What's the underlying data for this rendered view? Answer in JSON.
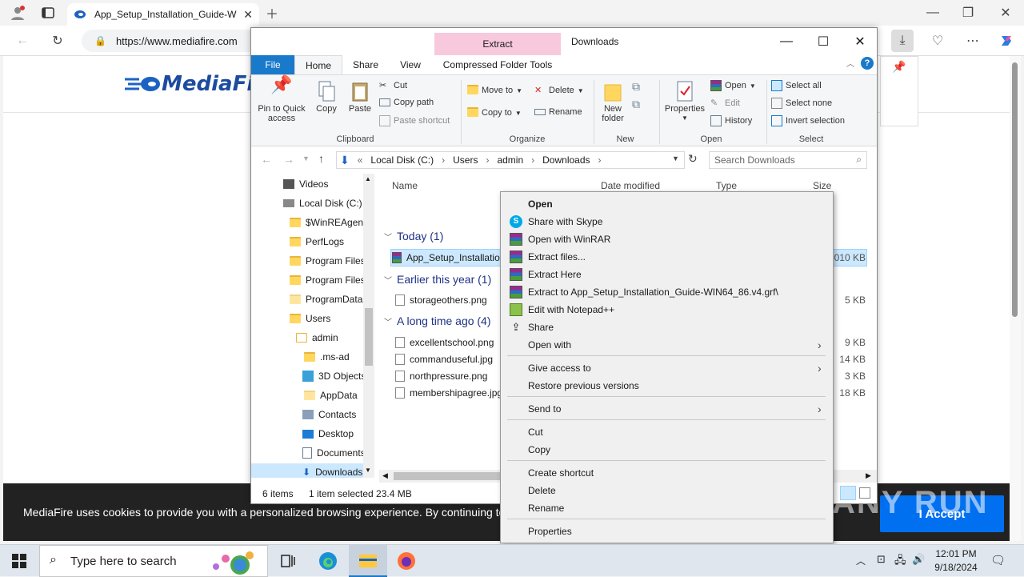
{
  "browser": {
    "tab_title": "App_Setup_Installation_Guide-W",
    "url": "https://www.mediafire.com"
  },
  "page": {
    "logo_text": "MediaFire",
    "cookie_text": "MediaFire uses cookies to provide you with a personalized browsing experience. By continuing to use th",
    "accept_label": "I Accept",
    "watermark": "ANY RUN"
  },
  "explorer": {
    "title": "Downloads",
    "contextual_tab": "Extract",
    "tabs": {
      "file": "File",
      "home": "Home",
      "share": "Share",
      "view": "View",
      "compressed": "Compressed Folder Tools"
    },
    "ribbon": {
      "pin": "Pin to Quick access",
      "copy": "Copy",
      "paste": "Paste",
      "cut": "Cut",
      "copy_path": "Copy path",
      "paste_shortcut": "Paste shortcut",
      "move_to": "Move to",
      "copy_to": "Copy to",
      "delete": "Delete",
      "rename": "Rename",
      "new_folder": "New folder",
      "properties": "Properties",
      "open": "Open",
      "edit": "Edit",
      "history": "History",
      "select_all": "Select all",
      "select_none": "Select none",
      "invert_selection": "Invert selection",
      "groups": {
        "clipboard": "Clipboard",
        "organize": "Organize",
        "new": "New",
        "open": "Open",
        "select": "Select"
      }
    },
    "breadcrumb": [
      "Local Disk (C:)",
      "Users",
      "admin",
      "Downloads"
    ],
    "search_placeholder": "Search Downloads",
    "nav": [
      {
        "label": "Videos"
      },
      {
        "label": "Local Disk (C:)"
      },
      {
        "label": "$WinREAgent"
      },
      {
        "label": "PerfLogs"
      },
      {
        "label": "Program Files"
      },
      {
        "label": "Program Files"
      },
      {
        "label": "ProgramData"
      },
      {
        "label": "Users"
      },
      {
        "label": "admin"
      },
      {
        "label": ".ms-ad"
      },
      {
        "label": "3D Objects"
      },
      {
        "label": "AppData"
      },
      {
        "label": "Contacts"
      },
      {
        "label": "Desktop"
      },
      {
        "label": "Documents"
      },
      {
        "label": "Downloads"
      }
    ],
    "columns": {
      "name": "Name",
      "date": "Date modified",
      "type": "Type",
      "size": "Size"
    },
    "groups": {
      "today": "Today (1)",
      "earlier": "Earlier this year (1)",
      "long_ago": "A long time ago (4)"
    },
    "files": [
      {
        "name": "App_Setup_Installatio",
        "size": ",010 KB"
      },
      {
        "name": "storageothers.png",
        "size": "5 KB"
      },
      {
        "name": "excellentschool.png",
        "size": "9 KB"
      },
      {
        "name": "commanduseful.jpg",
        "size": "14 KB"
      },
      {
        "name": "northpressure.png",
        "size": "3 KB"
      },
      {
        "name": "membershipagree.jpg",
        "size": "18 KB"
      }
    ],
    "status": {
      "items": "6 items",
      "selected": "1 item selected  23.4 MB"
    }
  },
  "context_menu": {
    "open": "Open",
    "skype": "Share with Skype",
    "winrar": "Open with WinRAR",
    "extract_files": "Extract files...",
    "extract_here": "Extract Here",
    "extract_to": "Extract to App_Setup_Installation_Guide-WIN64_86.v4.grf\\",
    "notepad": "Edit with Notepad++",
    "share": "Share",
    "open_with": "Open with",
    "give_access": "Give access to",
    "restore": "Restore previous versions",
    "send_to": "Send to",
    "cut": "Cut",
    "copy": "Copy",
    "create_shortcut": "Create shortcut",
    "delete": "Delete",
    "rename": "Rename",
    "properties": "Properties"
  },
  "taskbar": {
    "search_placeholder": "Type here to search",
    "time": "12:01 PM",
    "date": "9/18/2024"
  },
  "colors": {
    "accent": "#1979ca",
    "extract_tab": "#f8c8dc",
    "accept": "#0070f0"
  }
}
